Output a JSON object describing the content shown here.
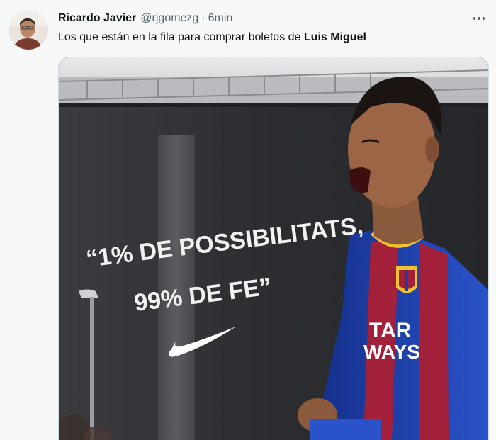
{
  "tweet": {
    "author_name": "Ricardo Javier",
    "handle": "@rjgomezg",
    "separator": "·",
    "time": "6min",
    "text_prefix": "Los que están en la fila para comprar boletos de ",
    "text_bold": "Luis Miguel"
  },
  "media": {
    "banner_line1": "“1% DE POSSIBILITATS,",
    "banner_line2": "99% DE FE”",
    "jersey_line1": "TAR",
    "jersey_line2": "WAYS",
    "logo": "swoosh-logo"
  },
  "icons": {
    "more": "more-options-icon"
  },
  "colors": {
    "text": "#0f1419",
    "muted": "#536471",
    "background": "#f7f9f9",
    "jersey_blue": "#1e3fa8",
    "jersey_red": "#a3203a"
  }
}
